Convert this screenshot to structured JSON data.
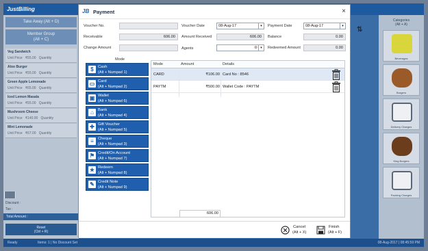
{
  "background": {
    "app_name": "JustBilling",
    "take_away": "Take Away (Alt + D)",
    "member_group": "Member Group",
    "member_group_key": "(Alt + C)",
    "items": [
      {
        "name": "Veg Sandwich",
        "unit_price": "Unit Price",
        "price": "₹55.00",
        "qty": "Quantity"
      },
      {
        "name": "Aloo Burger",
        "unit_price": "Unit Price",
        "price": "₹55.00",
        "qty": "Quantity"
      },
      {
        "name": "Green Apple Lemonade",
        "unit_price": "Unit Price",
        "price": "₹65.00",
        "qty": "Quantity"
      },
      {
        "name": "Iced Lemon Masala",
        "unit_price": "Unit Price",
        "price": "₹55.00",
        "qty": "Quantity"
      },
      {
        "name": "Mushroom Cheese",
        "unit_price": "Unit Price",
        "price": "₹140.00",
        "qty": "Quantity"
      },
      {
        "name": "Mint Lemonade",
        "unit_price": "Unit Price",
        "price": "₹67.00",
        "qty": "Quantity"
      }
    ],
    "discount": "Discount :",
    "tax": "Tax :",
    "total_amount": "Total Amount :",
    "reset": "Reset",
    "reset_key": "(Ctrl + R)",
    "categories": "Categories",
    "categories_key": "(Alt + A)",
    "category_tiles": [
      "Beverages",
      "Burgers",
      "Delivery Charges",
      "King Burgers",
      "Packing Charges"
    ],
    "status_left": "Ready",
    "status_mid": "Items: 1  | No Discount Set",
    "status_right": "08-Aug-2017 | 08:45:59 PM"
  },
  "modal": {
    "logo": "JB",
    "title": "Payment",
    "close": "×",
    "fields": {
      "voucher_no_label": "Voucher No.",
      "voucher_no_value": "",
      "voucher_date_label": "Voucher Date",
      "voucher_date_value": "08-Aug-17",
      "payment_date_label": "Payment Date",
      "payment_date_value": "08-Aug-17",
      "receivable_label": "Receivable",
      "receivable_value": "606.00",
      "amount_received_label": "Amount Received",
      "amount_received_value": "606.00",
      "balance_label": "Balance",
      "balance_value": "0.00",
      "change_amount_label": "Change Amount",
      "change_amount_value": "",
      "agents_label": "Agents",
      "agents_value": "",
      "redeemed_amount_label": "Redeemed Amount",
      "redeemed_amount_value": "0.00"
    },
    "mode_header": "Mode",
    "modes": [
      {
        "name": "Cash",
        "key": "(Alt + Numpad 1)",
        "icon": "cash-icon"
      },
      {
        "name": "Card",
        "key": "(Alt + Numpad 2)",
        "icon": "card-icon"
      },
      {
        "name": "Wallet",
        "key": "(Alt + Numpad 6)",
        "icon": "wallet-icon"
      },
      {
        "name": "Bank",
        "key": "(Alt + Numpad 4)",
        "icon": "bank-icon"
      },
      {
        "name": "Gift Voucher",
        "key": "(Alt + Numpad 5)",
        "icon": "gift-icon"
      },
      {
        "name": "Cheque",
        "key": "(Alt + Numpad 3)",
        "icon": "cheque-icon"
      },
      {
        "name": "Credit/On Account",
        "key": "(Alt + Numpad 7)",
        "icon": "credit-icon"
      },
      {
        "name": "Redeem",
        "key": "(Alt + Numpad 8)",
        "icon": "redeem-icon"
      },
      {
        "name": "Credit Note",
        "key": "(Alt + Numpad 9)",
        "icon": "credit-note-icon"
      }
    ],
    "grid": {
      "columns": [
        "Mode",
        "Amount",
        "Details"
      ],
      "rows": [
        {
          "mode": "CARD",
          "amount": "₹106.00",
          "details": "Card No : 8546"
        },
        {
          "mode": "PAYTM",
          "amount": "₹500.00",
          "details": "Wallet Code : PAYTM"
        }
      ],
      "total": "606.00"
    },
    "cancel_label": "Cancel",
    "cancel_key": "(Alt + X)",
    "finish_label": "Finish",
    "finish_key": "(Alt + F)"
  }
}
